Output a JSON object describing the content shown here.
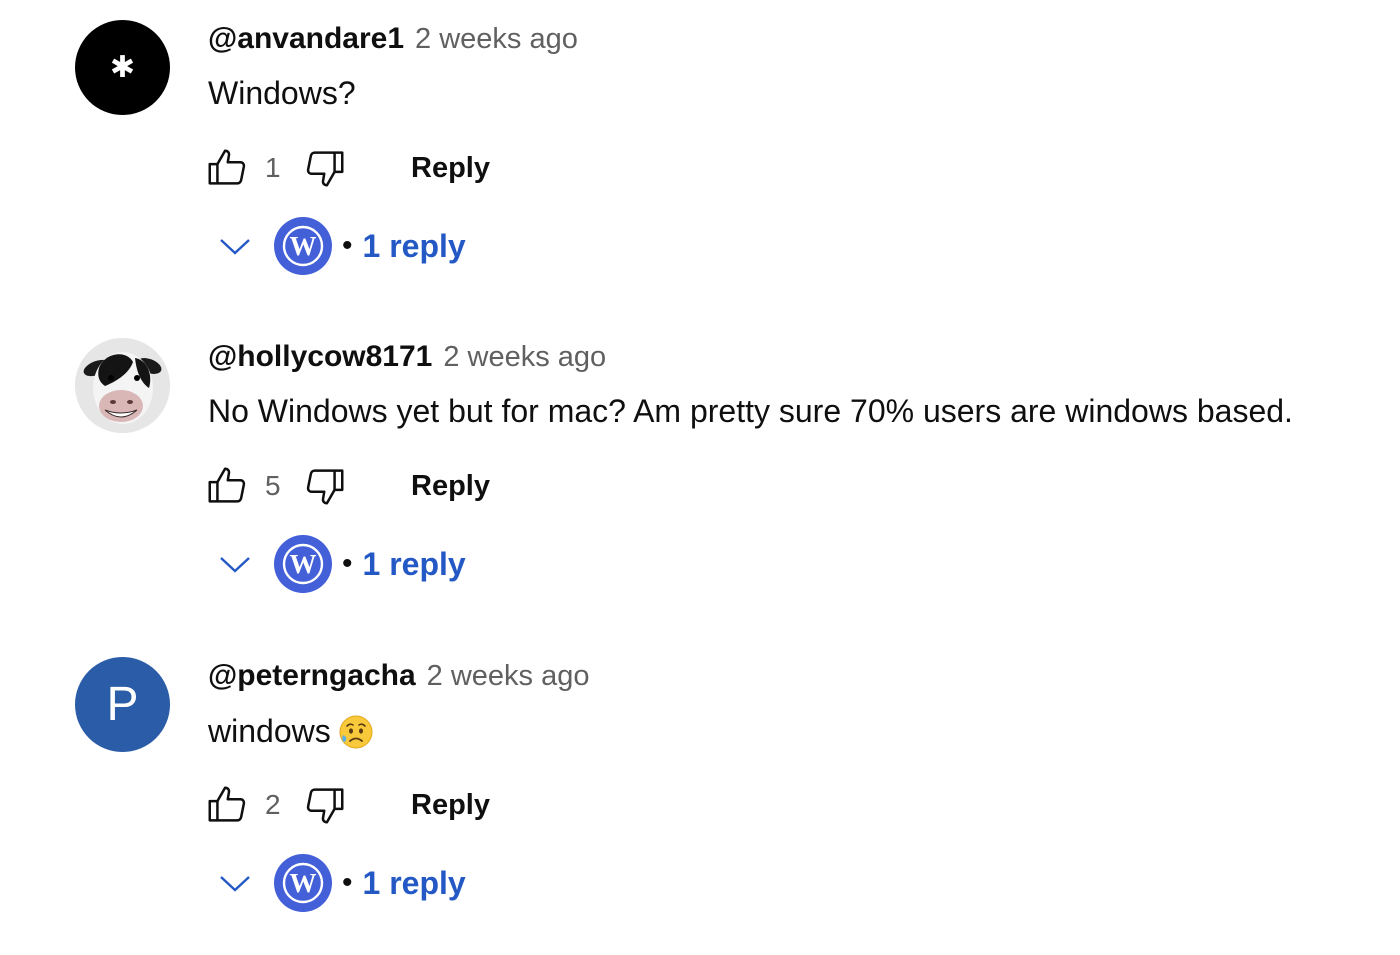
{
  "comments": [
    {
      "author": "@anvandare1",
      "time": "2 weeks ago",
      "text": "Windows?",
      "likes": "1",
      "reply_label": "Reply",
      "replies_label": "1 reply",
      "avatar_glyph": "✱"
    },
    {
      "author": "@hollycow8171",
      "time": "2 weeks ago",
      "text": "No Windows yet but for mac? Am pretty sure 70% users are windows based.",
      "likes": "5",
      "reply_label": "Reply",
      "replies_label": "1 reply"
    },
    {
      "author": "@peterngacha",
      "time": "2 weeks ago",
      "text": "windows",
      "likes": "2",
      "reply_label": "Reply",
      "replies_label": "1 reply",
      "avatar_letter": "P"
    }
  ],
  "separator": "•",
  "colors": {
    "reply_link": "#2358c5",
    "wp_avatar_bg": "#4360d8",
    "p_avatar_bg": "#2a5ca8",
    "muted_text": "#606060"
  },
  "icons": {
    "like": "thumbs-up-icon",
    "dislike": "thumbs-down-icon",
    "expand": "chevron-down-icon",
    "reply_avatar": "wordpress-logo",
    "emoji": "sad-but-relieved-face-emoji"
  }
}
